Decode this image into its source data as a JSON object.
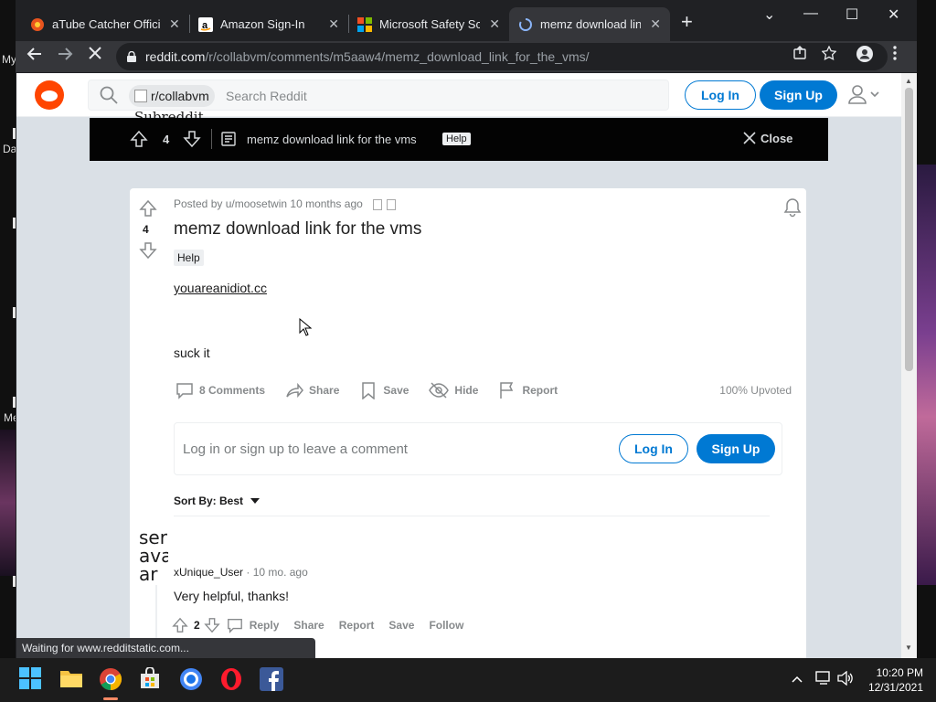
{
  "desktop": {
    "labels": [
      "My",
      "Da",
      "Me",
      "A"
    ]
  },
  "browser": {
    "tabs": [
      {
        "title": "aTube Catcher Officia",
        "icon": "atube-icon"
      },
      {
        "title": "Amazon Sign-In",
        "icon": "amazon-icon"
      },
      {
        "title": "Microsoft Safety Sca",
        "icon": "microsoft-icon"
      },
      {
        "title": "memz download link",
        "icon": "loading-spinner-icon",
        "active": true
      }
    ],
    "url_host": "reddit.com",
    "url_path": "/r/collabvm/comments/m5aaw4/memz_download_link_for_the_vms/",
    "status_text": "Waiting for www.redditstatic.com..."
  },
  "reddit_header": {
    "chip_label": "r/collabvm",
    "chip_sub": "Subreddit",
    "search_placeholder": "Search Reddit",
    "login": "Log In",
    "signup": "Sign Up"
  },
  "overlay": {
    "vote_count": "4",
    "title": "memz download link for the vms",
    "flair": "Help",
    "close": "Close"
  },
  "post": {
    "meta": "Posted by u/moosetwin 10 months ago",
    "vote_count": "4",
    "title": "memz download link for the vms",
    "flair": "Help",
    "link": "youareanidiot.cc",
    "text": "suck it",
    "actions": {
      "comments": "8 Comments",
      "share": "Share",
      "save": "Save",
      "hide": "Hide",
      "report": "Report"
    },
    "upvoted": "100% Upvoted",
    "comment_prompt": "Log in or sign up to leave a comment",
    "login": "Log In",
    "signup": "Sign Up",
    "sort_by": "Sort By: Best"
  },
  "comment": {
    "avatar_alt": "ser ava ar",
    "author": "xUnique_User",
    "time": " · 10 mo. ago",
    "body": "Very helpful, thanks!",
    "votes": "2",
    "actions": {
      "reply": "Reply",
      "share": "Share",
      "report": "Report",
      "save": "Save",
      "follow": "Follow"
    }
  },
  "taskbar": {
    "time": "10:20 PM",
    "date": "12/31/2021"
  },
  "colors": {
    "reddit_orange": "#ff4500",
    "reddit_blue": "#0079d3",
    "chrome_dark": "#202124"
  }
}
